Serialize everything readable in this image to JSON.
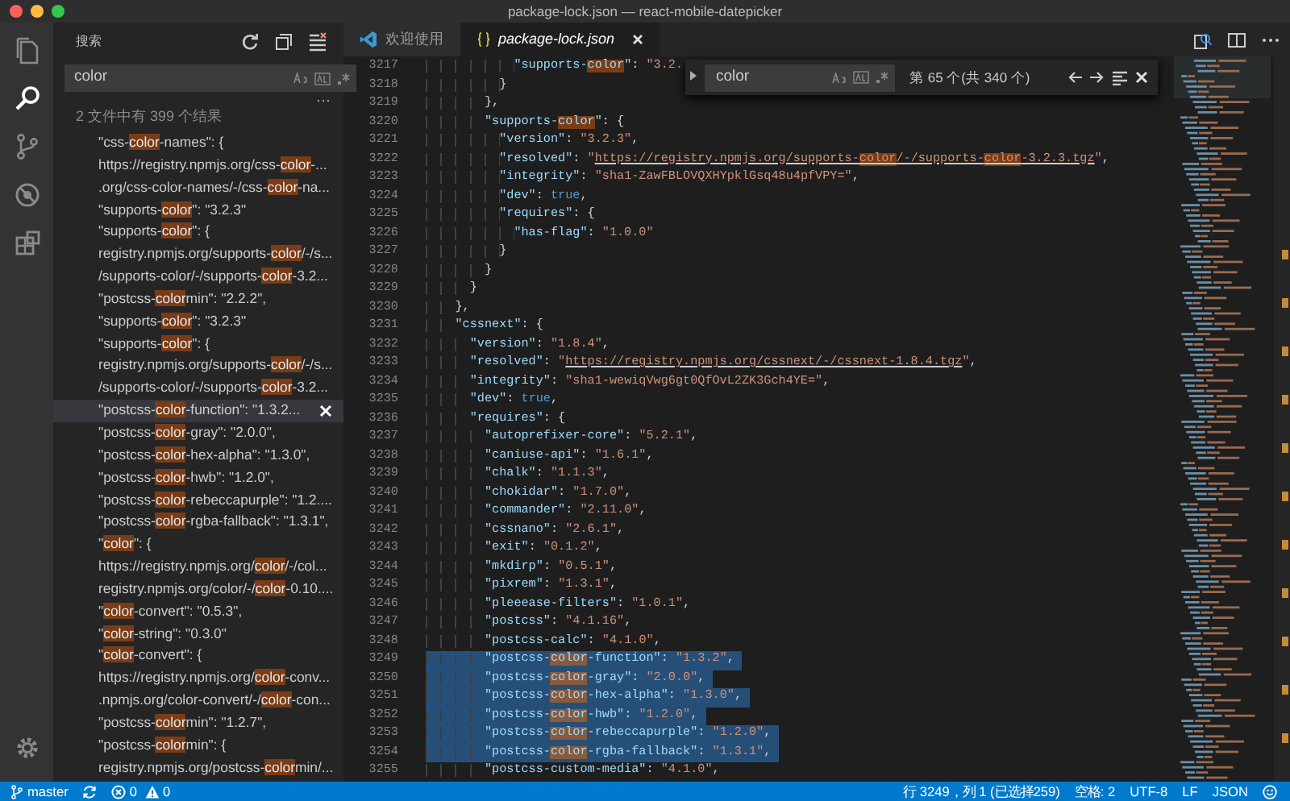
{
  "window": {
    "title": "package-lock.json — react-mobile-datepicker"
  },
  "activity_bar": [
    {
      "kind": "files",
      "selected": false
    },
    {
      "kind": "search",
      "selected": true
    },
    {
      "kind": "git",
      "selected": false
    },
    {
      "kind": "debug",
      "selected": false
    },
    {
      "kind": "extensions",
      "selected": false
    },
    {
      "kind": "settings",
      "selected": false
    }
  ],
  "sidebar": {
    "title": "搜索",
    "search": {
      "value": "color"
    },
    "more": "···",
    "summary": "2 文件中有 399 个结果",
    "results": [
      {
        "selected": false,
        "segments": [
          {
            "text": "\"css-",
            "found": false
          },
          {
            "text": "color",
            "found": true
          },
          {
            "text": "-names\": {",
            "found": false
          }
        ]
      },
      {
        "selected": false,
        "segments": [
          {
            "text": "https://registry.npmjs.org/css-",
            "found": false
          },
          {
            "text": "color",
            "found": true
          },
          {
            "text": "-...",
            "found": false
          }
        ]
      },
      {
        "selected": false,
        "segments": [
          {
            "text": ".org/css-color-names/-/css-",
            "found": false
          },
          {
            "text": "color",
            "found": true
          },
          {
            "text": "-na...",
            "found": false
          }
        ]
      },
      {
        "selected": false,
        "segments": [
          {
            "text": "\"supports-",
            "found": false
          },
          {
            "text": "color",
            "found": true
          },
          {
            "text": "\": \"3.2.3\"",
            "found": false
          }
        ]
      },
      {
        "selected": false,
        "segments": [
          {
            "text": "\"supports-",
            "found": false
          },
          {
            "text": "color",
            "found": true
          },
          {
            "text": "\": {",
            "found": false
          }
        ]
      },
      {
        "selected": false,
        "segments": [
          {
            "text": "registry.npmjs.org/supports-",
            "found": false
          },
          {
            "text": "color",
            "found": true
          },
          {
            "text": "/-/s...",
            "found": false
          }
        ]
      },
      {
        "selected": false,
        "segments": [
          {
            "text": "/supports-color/-/supports-",
            "found": false
          },
          {
            "text": "color",
            "found": true
          },
          {
            "text": "-3.2...",
            "found": false
          }
        ]
      },
      {
        "selected": false,
        "segments": [
          {
            "text": "\"postcss-",
            "found": false
          },
          {
            "text": "color",
            "found": true
          },
          {
            "text": "min\": \"2.2.2\",",
            "found": false
          }
        ]
      },
      {
        "selected": false,
        "segments": [
          {
            "text": "\"supports-",
            "found": false
          },
          {
            "text": "color",
            "found": true
          },
          {
            "text": "\": \"3.2.3\"",
            "found": false
          }
        ]
      },
      {
        "selected": false,
        "segments": [
          {
            "text": "\"supports-",
            "found": false
          },
          {
            "text": "color",
            "found": true
          },
          {
            "text": "\": {",
            "found": false
          }
        ]
      },
      {
        "selected": false,
        "segments": [
          {
            "text": "registry.npmjs.org/supports-",
            "found": false
          },
          {
            "text": "color",
            "found": true
          },
          {
            "text": "/-/s...",
            "found": false
          }
        ]
      },
      {
        "selected": false,
        "segments": [
          {
            "text": "/supports-color/-/supports-",
            "found": false
          },
          {
            "text": "color",
            "found": true
          },
          {
            "text": "-3.2...",
            "found": false
          }
        ]
      },
      {
        "selected": true,
        "segments": [
          {
            "text": "\"postcss-",
            "found": false
          },
          {
            "text": "color",
            "found": true
          },
          {
            "text": "-function\": \"1.3.2...",
            "found": false
          }
        ]
      },
      {
        "selected": false,
        "segments": [
          {
            "text": "\"postcss-",
            "found": false
          },
          {
            "text": "color",
            "found": true
          },
          {
            "text": "-gray\": \"2.0.0\",",
            "found": false
          }
        ]
      },
      {
        "selected": false,
        "segments": [
          {
            "text": "\"postcss-",
            "found": false
          },
          {
            "text": "color",
            "found": true
          },
          {
            "text": "-hex-alpha\": \"1.3.0\",",
            "found": false
          }
        ]
      },
      {
        "selected": false,
        "segments": [
          {
            "text": "\"postcss-",
            "found": false
          },
          {
            "text": "color",
            "found": true
          },
          {
            "text": "-hwb\": \"1.2.0\",",
            "found": false
          }
        ]
      },
      {
        "selected": false,
        "segments": [
          {
            "text": "\"postcss-",
            "found": false
          },
          {
            "text": "color",
            "found": true
          },
          {
            "text": "-rebeccapurple\": \"1.2....",
            "found": false
          }
        ]
      },
      {
        "selected": false,
        "segments": [
          {
            "text": "\"postcss-",
            "found": false
          },
          {
            "text": "color",
            "found": true
          },
          {
            "text": "-rgba-fallback\": \"1.3.1\",",
            "found": false
          }
        ]
      },
      {
        "selected": false,
        "segments": [
          {
            "text": "\"",
            "found": false
          },
          {
            "text": "color",
            "found": true
          },
          {
            "text": "\": {",
            "found": false
          }
        ]
      },
      {
        "selected": false,
        "segments": [
          {
            "text": "https://registry.npmjs.org/",
            "found": false
          },
          {
            "text": "color",
            "found": true
          },
          {
            "text": "/-/col...",
            "found": false
          }
        ]
      },
      {
        "selected": false,
        "segments": [
          {
            "text": "registry.npmjs.org/color/-/",
            "found": false
          },
          {
            "text": "color",
            "found": true
          },
          {
            "text": "-0.10....",
            "found": false
          }
        ]
      },
      {
        "selected": false,
        "segments": [
          {
            "text": "\"",
            "found": false
          },
          {
            "text": "color",
            "found": true
          },
          {
            "text": "-convert\": \"0.5.3\",",
            "found": false
          }
        ]
      },
      {
        "selected": false,
        "segments": [
          {
            "text": "\"",
            "found": false
          },
          {
            "text": "color",
            "found": true
          },
          {
            "text": "-string\": \"0.3.0\"",
            "found": false
          }
        ]
      },
      {
        "selected": false,
        "segments": [
          {
            "text": "\"",
            "found": false
          },
          {
            "text": "color",
            "found": true
          },
          {
            "text": "-convert\": {",
            "found": false
          }
        ]
      },
      {
        "selected": false,
        "segments": [
          {
            "text": "https://registry.npmjs.org/",
            "found": false
          },
          {
            "text": "color",
            "found": true
          },
          {
            "text": "-conv...",
            "found": false
          }
        ]
      },
      {
        "selected": false,
        "segments": [
          {
            "text": ".npmjs.org/color-convert/-/",
            "found": false
          },
          {
            "text": "color",
            "found": true
          },
          {
            "text": "-con...",
            "found": false
          }
        ]
      },
      {
        "selected": false,
        "segments": [
          {
            "text": "\"postcss-",
            "found": false
          },
          {
            "text": "color",
            "found": true
          },
          {
            "text": "min\": \"1.2.7\",",
            "found": false
          }
        ]
      },
      {
        "selected": false,
        "segments": [
          {
            "text": "\"postcss-",
            "found": false
          },
          {
            "text": "color",
            "found": true
          },
          {
            "text": "min\": {",
            "found": false
          }
        ]
      },
      {
        "selected": false,
        "segments": [
          {
            "text": "registry.npmjs.org/postcss-",
            "found": false
          },
          {
            "text": "color",
            "found": true
          },
          {
            "text": "min/...",
            "found": false
          }
        ]
      }
    ]
  },
  "tabs": [
    {
      "label": "欢迎使用",
      "kind": "welcome",
      "selected": false
    },
    {
      "label": "package-lock.json",
      "kind": "json",
      "selected": true
    }
  ],
  "find": {
    "value": "color",
    "count": "第 65 个(共 340 个)"
  },
  "editor": {
    "lines": [
      {
        "number": "3217",
        "selected": false,
        "segments": [
          {
            "text": "            \"supports-",
            "found": false,
            "link": false
          },
          {
            "text": "color",
            "found": true,
            "link": false
          },
          {
            "text": "\": \"3.2.",
            "found": false,
            "link": false
          }
        ]
      },
      {
        "number": "3218",
        "selected": false,
        "segments": [
          {
            "text": "          }",
            "found": false,
            "link": false
          }
        ]
      },
      {
        "number": "3219",
        "selected": false,
        "segments": [
          {
            "text": "        },",
            "found": false,
            "link": false
          }
        ]
      },
      {
        "number": "3220",
        "selected": false,
        "segments": [
          {
            "text": "        \"supports-",
            "found": false,
            "link": false
          },
          {
            "text": "color",
            "found": true,
            "link": false
          },
          {
            "text": "\": {",
            "found": false,
            "link": false
          }
        ]
      },
      {
        "number": "3221",
        "selected": false,
        "segments": [
          {
            "text": "          \"version\": \"3.2.3\",",
            "found": false,
            "link": false
          }
        ]
      },
      {
        "number": "3222",
        "selected": false,
        "segments": [
          {
            "text": "          \"resolved\": \"",
            "found": false,
            "link": false
          },
          {
            "text": "https://registry.npmjs.org/supports-",
            "found": false,
            "link": true
          },
          {
            "text": "color",
            "found": true,
            "link": true
          },
          {
            "text": "/-/supports-",
            "found": false,
            "link": true
          },
          {
            "text": "color",
            "found": true,
            "link": true
          },
          {
            "text": "-3.2.3.tgz",
            "found": false,
            "link": true
          },
          {
            "text": "\",",
            "found": false,
            "link": false
          }
        ]
      },
      {
        "number": "3223",
        "selected": false,
        "segments": [
          {
            "text": "          \"integrity\": \"sha1-ZawFBLOVQXHYpklGsq48u4pfVPY=\",",
            "found": false,
            "link": false
          }
        ]
      },
      {
        "number": "3224",
        "selected": false,
        "segments": [
          {
            "text": "          \"dev\": true,",
            "found": false,
            "link": false
          }
        ]
      },
      {
        "number": "3225",
        "selected": false,
        "segments": [
          {
            "text": "          \"requires\": {",
            "found": false,
            "link": false
          }
        ]
      },
      {
        "number": "3226",
        "selected": false,
        "segments": [
          {
            "text": "            \"has-flag\": \"1.0.0\"",
            "found": false,
            "link": false
          }
        ]
      },
      {
        "number": "3227",
        "selected": false,
        "segments": [
          {
            "text": "          }",
            "found": false,
            "link": false
          }
        ]
      },
      {
        "number": "3228",
        "selected": false,
        "segments": [
          {
            "text": "        }",
            "found": false,
            "link": false
          }
        ]
      },
      {
        "number": "3229",
        "selected": false,
        "segments": [
          {
            "text": "      }",
            "found": false,
            "link": false
          }
        ]
      },
      {
        "number": "3230",
        "selected": false,
        "segments": [
          {
            "text": "    },",
            "found": false,
            "link": false
          }
        ]
      },
      {
        "number": "3231",
        "selected": false,
        "segments": [
          {
            "text": "    \"cssnext\": {",
            "found": false,
            "link": false
          }
        ]
      },
      {
        "number": "3232",
        "selected": false,
        "segments": [
          {
            "text": "      \"version\": \"1.8.4\",",
            "found": false,
            "link": false
          }
        ]
      },
      {
        "number": "3233",
        "selected": false,
        "segments": [
          {
            "text": "      \"resolved\": \"",
            "found": false,
            "link": false
          },
          {
            "text": "https://registry.npmjs.org/cssnext/-/cssnext-1.8.4.tgz",
            "found": false,
            "link": true
          },
          {
            "text": "\",",
            "found": false,
            "link": false
          }
        ]
      },
      {
        "number": "3234",
        "selected": false,
        "segments": [
          {
            "text": "      \"integrity\": \"sha1-wewiqVwg6gt0QfOvL2ZK3Gch4YE=\",",
            "found": false,
            "link": false
          }
        ]
      },
      {
        "number": "3235",
        "selected": false,
        "segments": [
          {
            "text": "      \"dev\": true,",
            "found": false,
            "link": false
          }
        ]
      },
      {
        "number": "3236",
        "selected": false,
        "segments": [
          {
            "text": "      \"requires\": {",
            "found": false,
            "link": false
          }
        ]
      },
      {
        "number": "3237",
        "selected": false,
        "segments": [
          {
            "text": "        \"autoprefixer-core\": \"5.2.1\",",
            "found": false,
            "link": false
          }
        ]
      },
      {
        "number": "3238",
        "selected": false,
        "segments": [
          {
            "text": "        \"caniuse-api\": \"1.6.1\",",
            "found": false,
            "link": false
          }
        ]
      },
      {
        "number": "3239",
        "selected": false,
        "segments": [
          {
            "text": "        \"chalk\": \"1.1.3\",",
            "found": false,
            "link": false
          }
        ]
      },
      {
        "number": "3240",
        "selected": false,
        "segments": [
          {
            "text": "        \"chokidar\": \"1.7.0\",",
            "found": false,
            "link": false
          }
        ]
      },
      {
        "number": "3241",
        "selected": false,
        "segments": [
          {
            "text": "        \"commander\": \"2.11.0\",",
            "found": false,
            "link": false
          }
        ]
      },
      {
        "number": "3242",
        "selected": false,
        "segments": [
          {
            "text": "        \"cssnano\": \"2.6.1\",",
            "found": false,
            "link": false
          }
        ]
      },
      {
        "number": "3243",
        "selected": false,
        "segments": [
          {
            "text": "        \"exit\": \"0.1.2\",",
            "found": false,
            "link": false
          }
        ]
      },
      {
        "number": "3244",
        "selected": false,
        "segments": [
          {
            "text": "        \"mkdirp\": \"0.5.1\",",
            "found": false,
            "link": false
          }
        ]
      },
      {
        "number": "3245",
        "selected": false,
        "segments": [
          {
            "text": "        \"pixrem\": \"1.3.1\",",
            "found": false,
            "link": false
          }
        ]
      },
      {
        "number": "3246",
        "selected": false,
        "segments": [
          {
            "text": "        \"pleeease-filters\": \"1.0.1\",",
            "found": false,
            "link": false
          }
        ]
      },
      {
        "number": "3247",
        "selected": false,
        "segments": [
          {
            "text": "        \"postcss\": \"4.1.16\",",
            "found": false,
            "link": false
          }
        ]
      },
      {
        "number": "3248",
        "selected": false,
        "segments": [
          {
            "text": "        \"postcss-calc\": \"4.1.0\",",
            "found": false,
            "link": false
          }
        ]
      },
      {
        "number": "3249",
        "selected": true,
        "segments": [
          {
            "text": "        \"postcss-",
            "found": false,
            "link": false
          },
          {
            "text": "color",
            "found": true,
            "link": false
          },
          {
            "text": "-function\": \"1.3.2\",",
            "found": false,
            "link": false
          }
        ]
      },
      {
        "number": "3250",
        "selected": true,
        "segments": [
          {
            "text": "        \"postcss-",
            "found": false,
            "link": false
          },
          {
            "text": "color",
            "found": true,
            "link": false
          },
          {
            "text": "-gray\": \"2.0.0\",",
            "found": false,
            "link": false
          }
        ]
      },
      {
        "number": "3251",
        "selected": true,
        "segments": [
          {
            "text": "        \"postcss-",
            "found": false,
            "link": false
          },
          {
            "text": "color",
            "found": true,
            "link": false
          },
          {
            "text": "-hex-alpha\": \"1.3.0\",",
            "found": false,
            "link": false
          }
        ]
      },
      {
        "number": "3252",
        "selected": true,
        "segments": [
          {
            "text": "        \"postcss-",
            "found": false,
            "link": false
          },
          {
            "text": "color",
            "found": true,
            "link": false
          },
          {
            "text": "-hwb\": \"1.2.0\",",
            "found": false,
            "link": false
          }
        ]
      },
      {
        "number": "3253",
        "selected": true,
        "segments": [
          {
            "text": "        \"postcss-",
            "found": false,
            "link": false
          },
          {
            "text": "color",
            "found": true,
            "link": false
          },
          {
            "text": "-rebeccapurple\": \"1.2.0\",",
            "found": false,
            "link": false
          }
        ]
      },
      {
        "number": "3254",
        "selected": true,
        "segments": [
          {
            "text": "        \"postcss-",
            "found": false,
            "link": false
          },
          {
            "text": "color",
            "found": true,
            "link": false
          },
          {
            "text": "-rgba-fallback\": \"1.3.1\",",
            "found": false,
            "link": false
          }
        ]
      },
      {
        "number": "3255",
        "selected": false,
        "segments": [
          {
            "text": "        \"postcss-custom-media\": \"4.1.0\",",
            "found": false,
            "link": false
          }
        ]
      }
    ]
  },
  "status_bar": {
    "branch": "master",
    "errors": "0",
    "warnings": "0",
    "position": "行 3249，列 1 (已选择259)",
    "indent": "空格: 2",
    "encoding": "UTF-8",
    "eol": "LF",
    "language": "JSON"
  }
}
